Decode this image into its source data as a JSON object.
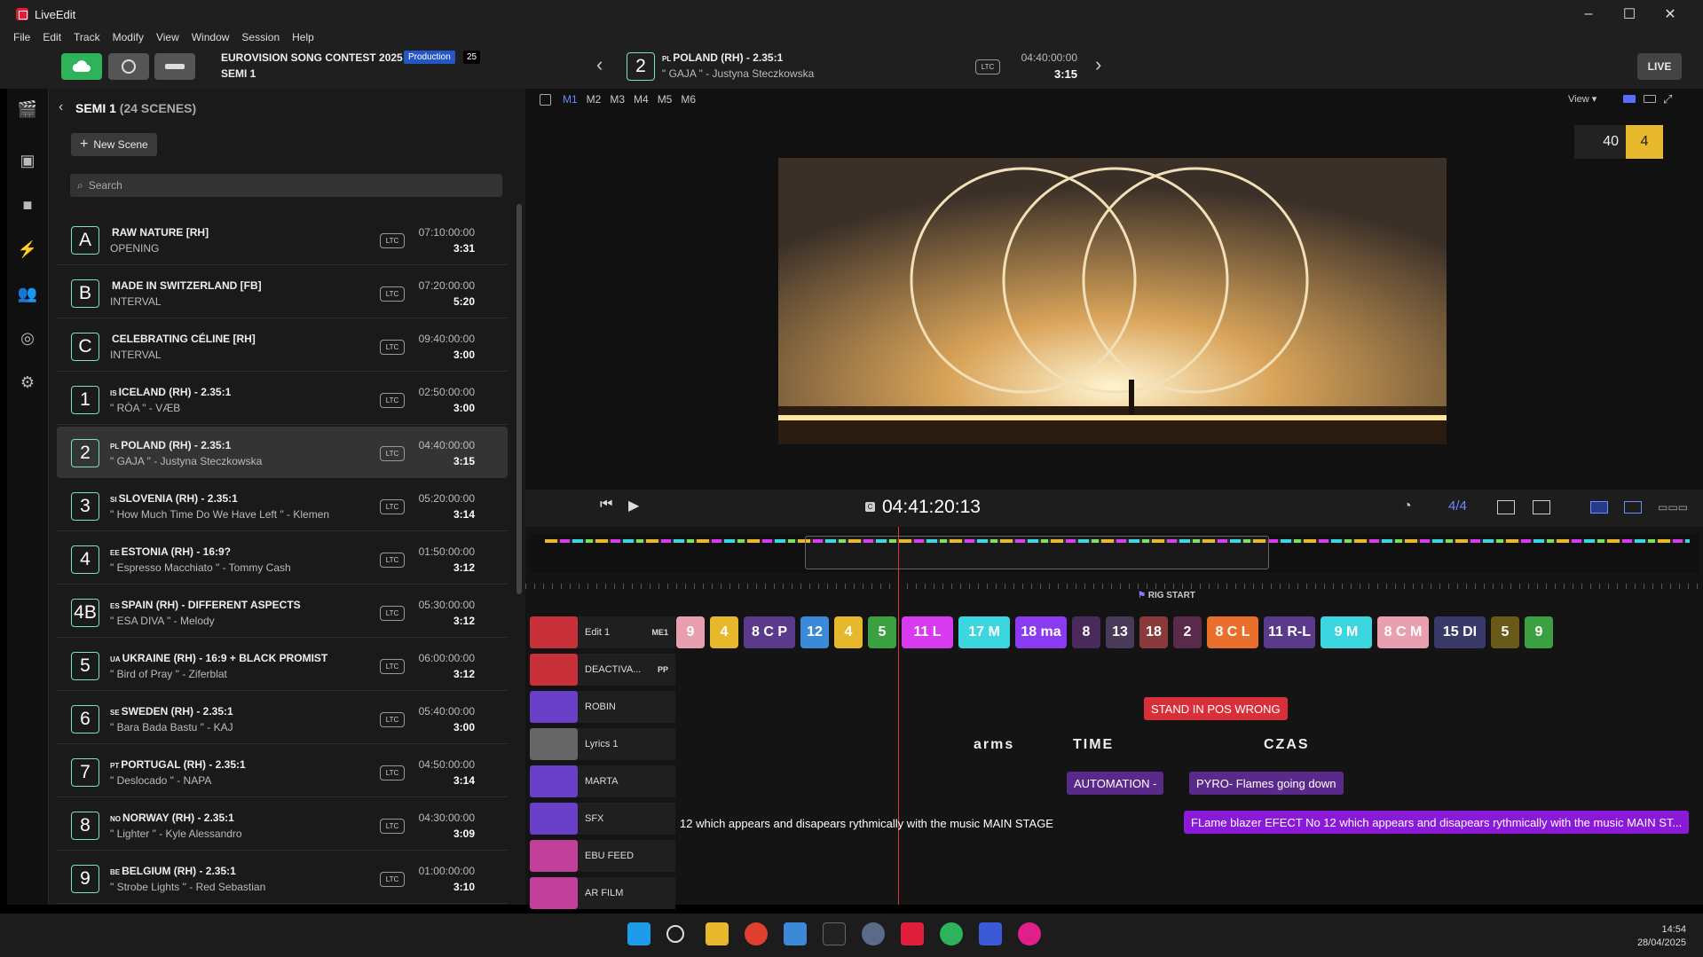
{
  "window": {
    "title": "LiveEdit",
    "minimize": "–",
    "maximize": "☐",
    "close": "✕"
  },
  "menu": [
    "File",
    "Edit",
    "Track",
    "Modify",
    "View",
    "Window",
    "Session",
    "Help"
  ],
  "header": {
    "show_name": "EUROVISION SONG CONTEST 2025",
    "badge": "Production",
    "badge_count": "25",
    "session": "SEMI 1"
  },
  "current_scene": {
    "number": "2",
    "flag": "PL",
    "title": "POLAND (RH) - 2.35:1",
    "subtitle": "\" GAJA \" - Justyna Steczkowska",
    "ltc": "LTC",
    "timecode": "04:40:00:00",
    "duration": "3:15"
  },
  "live_label": "LIVE",
  "panel": {
    "title": "SEMI 1",
    "count": "(24 SCENES)",
    "new_scene": "New Scene",
    "search_placeholder": "Search"
  },
  "scenes": [
    {
      "badge": "A",
      "flag": "",
      "title": "RAW NATURE [RH]",
      "sub": "OPENING",
      "tc": "07:10:00:00",
      "dur": "3:31"
    },
    {
      "badge": "B",
      "flag": "",
      "title": "MADE IN SWITZERLAND [FB]",
      "sub": "INTERVAL",
      "tc": "07:20:00:00",
      "dur": "5:20"
    },
    {
      "badge": "C",
      "flag": "",
      "title": "CELEBRATING CÉLINE [RH]",
      "sub": "INTERVAL",
      "tc": "09:40:00:00",
      "dur": "3:00"
    },
    {
      "badge": "1",
      "flag": "IS",
      "title": "ICELAND (RH) - 2.35:1",
      "sub": "\" RÓA \" - VÆB",
      "tc": "02:50:00:00",
      "dur": "3:00"
    },
    {
      "badge": "2",
      "flag": "PL",
      "title": "POLAND (RH) - 2.35:1",
      "sub": "\" GAJA \" - Justyna Steczkowska",
      "tc": "04:40:00:00",
      "dur": "3:15"
    },
    {
      "badge": "3",
      "flag": "SI",
      "title": "SLOVENIA (RH) - 2.35:1",
      "sub": "\" How Much Time Do We Have Left \" - Klemen",
      "tc": "05:20:00:00",
      "dur": "3:14"
    },
    {
      "badge": "4",
      "flag": "EE",
      "title": "ESTONIA (RH) - 16:9?",
      "sub": "\" Espresso Macchiato \" - Tommy Cash",
      "tc": "01:50:00:00",
      "dur": "3:12"
    },
    {
      "badge": "4B",
      "flag": "ES",
      "title": "SPAIN (RH) - DIFFERENT ASPECTS",
      "sub": "\" ESA DIVA \" - Melody",
      "tc": "05:30:00:00",
      "dur": "3:12"
    },
    {
      "badge": "5",
      "flag": "UA",
      "title": "UKRAINE (RH) - 16:9 + BLACK PROMIST",
      "sub": "\" Bird of Pray \" - Ziferblat",
      "tc": "06:00:00:00",
      "dur": "3:12"
    },
    {
      "badge": "6",
      "flag": "SE",
      "title": "SWEDEN (RH) - 2.35:1",
      "sub": "\" Bara Bada Bastu \" - KAJ",
      "tc": "05:40:00:00",
      "dur": "3:00"
    },
    {
      "badge": "7",
      "flag": "PT",
      "title": "PORTUGAL (RH) - 2.35:1",
      "sub": "\" Deslocado \" - NAPA",
      "tc": "04:50:00:00",
      "dur": "3:14"
    },
    {
      "badge": "8",
      "flag": "NO",
      "title": "NORWAY (RH) - 2.35:1",
      "sub": "\" Lighter \" - Kyle Alessandro",
      "tc": "04:30:00:00",
      "dur": "3:09"
    },
    {
      "badge": "9",
      "flag": "BE",
      "title": "BELGIUM (RH) - 2.35:1",
      "sub": "\" Strobe Lights \" - Red Sebastian",
      "tc": "01:00:00:00",
      "dur": "3:10"
    }
  ],
  "viewer": {
    "tabs": [
      "M1",
      "M2",
      "M3",
      "M4",
      "M5",
      "M6"
    ],
    "view_label": "View",
    "counter_left": "40",
    "counter_right": "4"
  },
  "transport": {
    "timecode": "04:41:20:13",
    "tc_prefix": "C",
    "time_sig": "4/4"
  },
  "timeline": {
    "marker": "RIG START",
    "tracks": [
      {
        "name": "Edit 1",
        "tag": "ME1",
        "color": "#c8303a"
      },
      {
        "name": "DEACTIVA...",
        "tag": "PP",
        "color": "#c8303a"
      },
      {
        "name": "ROBIN",
        "tag": "",
        "color": "#6a3fc8"
      },
      {
        "name": "Lyrics 1",
        "tag": "",
        "color": "#666666"
      },
      {
        "name": "MARTA",
        "tag": "",
        "color": "#6a3fc8"
      },
      {
        "name": "SFX",
        "tag": "",
        "color": "#6a3fc8"
      },
      {
        "name": "EBU FEED",
        "tag": "",
        "color": "#c0409a"
      },
      {
        "name": "AR FILM",
        "tag": "",
        "color": "#c0409a"
      }
    ],
    "clips": [
      "9",
      "4",
      "8 C P",
      "12",
      "4",
      "5",
      "11 L",
      "17 M",
      "18 ma",
      "8",
      "13",
      "18",
      "2",
      "8 C L",
      "11 R-L",
      "9 M",
      "8 C M",
      "15 DI",
      "5",
      "9"
    ],
    "robin_flag": "STAND IN POS WRONG",
    "lyrics": [
      "arms",
      "TIME",
      "CZAS"
    ],
    "marta_flags": [
      "AUTOMATION -",
      "PYRO- Flames going down"
    ],
    "sfx_text": "12 which appears and disapears rythmically with the music MAIN STAGE",
    "sfx_flag": "FLame blazer EFECT No 12 which appears and disapears rythmically with the music MAIN ST..."
  },
  "taskbar": {
    "time": "14:54",
    "date": "28/04/2025"
  }
}
